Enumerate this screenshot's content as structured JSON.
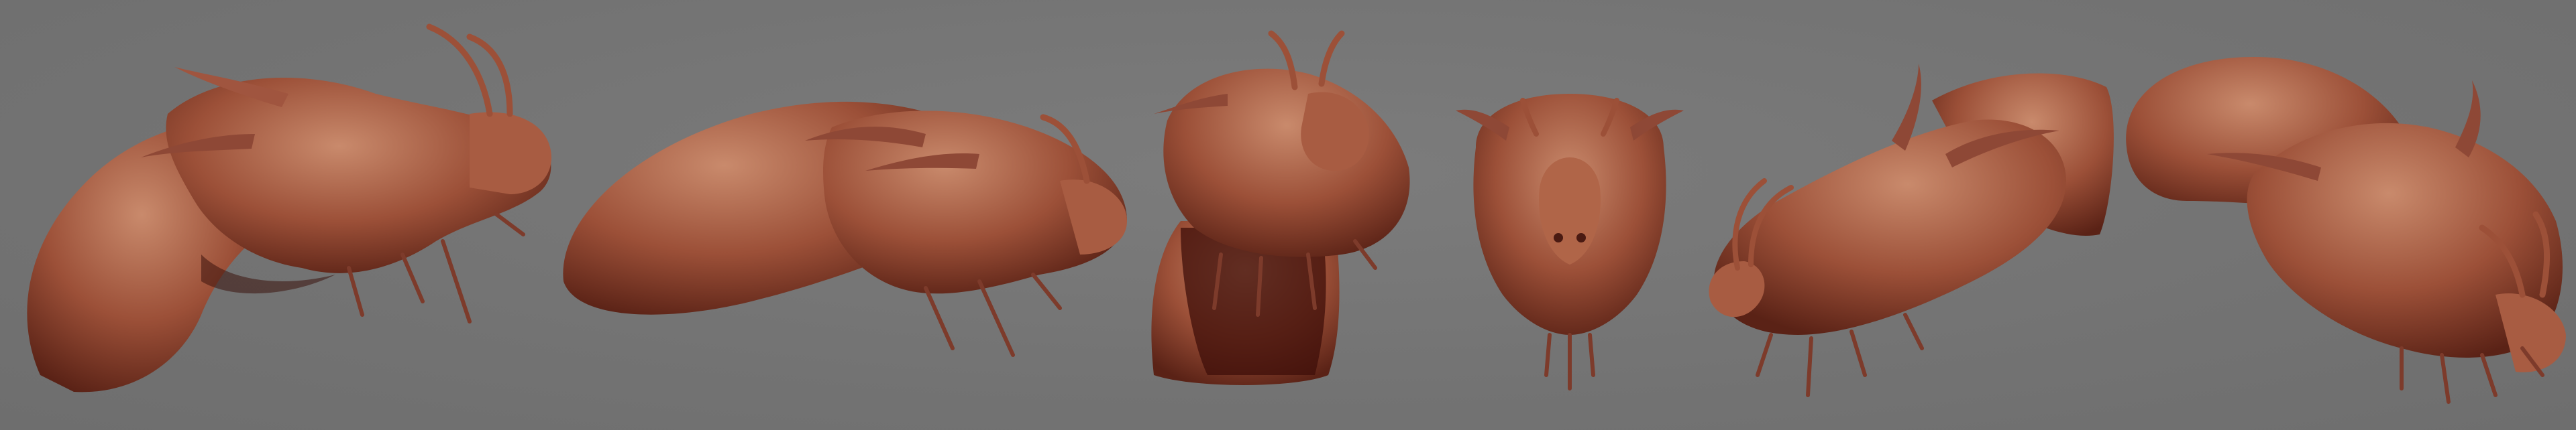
{
  "background_color": "#757575",
  "clay_color": "#a0553f",
  "clay_highlight": "#c98a6c",
  "clay_shadow": "#4a1a12",
  "views": [
    {
      "name": "three-quarter-right"
    },
    {
      "name": "side-right"
    },
    {
      "name": "three-quarter-front"
    },
    {
      "name": "front"
    },
    {
      "name": "three-quarter-left-low"
    },
    {
      "name": "three-quarter-left-high"
    }
  ]
}
